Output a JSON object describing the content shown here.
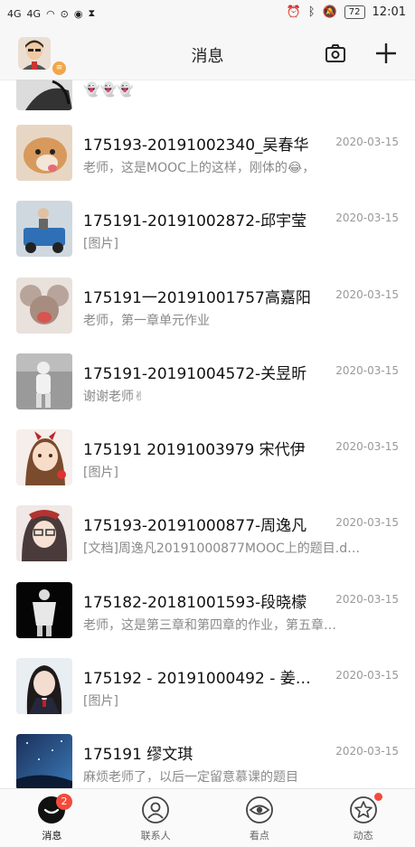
{
  "status_bar": {
    "signal1": "4G",
    "signal2": "4G",
    "battery": "72",
    "time": "12:01"
  },
  "header": {
    "title": "消息"
  },
  "conversations": [
    {
      "name": "175193-20191002340_吴春华",
      "date": "2020-03-15",
      "preview": "老师，这是MOOC上的这样，刚体的😂，"
    },
    {
      "name": "175191-20191002872-邱宇莹",
      "date": "2020-03-15",
      "preview": "[图片]"
    },
    {
      "name": "175191一20191001757高嘉阳",
      "date": "2020-03-15",
      "preview": "老师，第一章单元作业"
    },
    {
      "name": "175191-20191004572-关昱昕",
      "date": "2020-03-15",
      "preview": "谢谢老师✌"
    },
    {
      "name": "175191  20191003979  宋代伊",
      "date": "2020-03-15",
      "preview": "[图片]"
    },
    {
      "name": "175193-20191000877-周逸凡",
      "date": "2020-03-15",
      "preview": "[文档]周逸凡20191000877MOOC上的题目.d…"
    },
    {
      "name": "175182-20181001593-段晓檬",
      "date": "2020-03-15",
      "preview": "老师，这是第三章和第四章的作业，第五章…"
    },
    {
      "name": "175192 - 20191000492 - 姜…",
      "date": "2020-03-15",
      "preview": "[图片]"
    },
    {
      "name": "175191 缪文琪",
      "date": "2020-03-15",
      "preview": "麻烦老师了，以后一定留意慕课的题目"
    }
  ],
  "tabs": [
    {
      "label": "消息",
      "badge": "2",
      "icon": "message-icon"
    },
    {
      "label": "联系人",
      "icon": "contacts-icon"
    },
    {
      "label": "看点",
      "icon": "eye-icon"
    },
    {
      "label": "动态",
      "icon": "star-icon"
    }
  ]
}
